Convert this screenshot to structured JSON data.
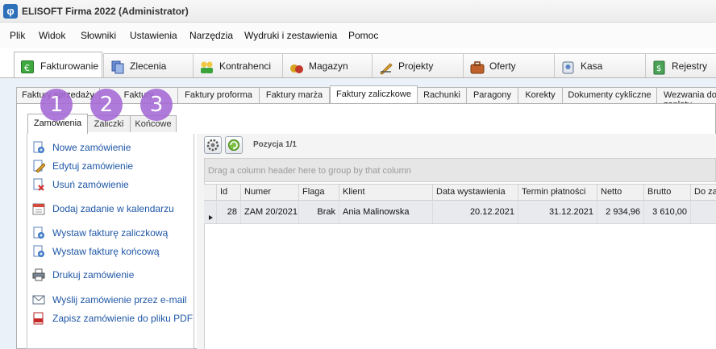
{
  "window": {
    "title": "ELISOFT Firma 2022 (Administrator)",
    "app_icon": "phi-logo-icon"
  },
  "menu": [
    "Plik",
    "Widok",
    "Słowniki",
    "Ustawienia",
    "Narzędzia",
    "Wydruki i zestawienia",
    "Pomoc"
  ],
  "main_tabs": [
    {
      "label": "Fakturowanie",
      "icon": "currency-icon",
      "active": true
    },
    {
      "label": "Zlecenia",
      "icon": "documents-icon"
    },
    {
      "label": "Kontrahenci",
      "icon": "people-icon"
    },
    {
      "label": "Magazyn",
      "icon": "bags-icon"
    },
    {
      "label": "Projekty",
      "icon": "pencil-ruler-icon"
    },
    {
      "label": "Oferty",
      "icon": "briefcase-icon"
    },
    {
      "label": "Kasa",
      "icon": "cash-register-icon"
    },
    {
      "label": "Rejestry",
      "icon": "register-book-icon"
    }
  ],
  "sub_tabs": [
    {
      "label": "Faktury sprzedaży"
    },
    {
      "label": "Faktury"
    },
    {
      "label": "Faktury proforma"
    },
    {
      "label": "Faktury marża"
    },
    {
      "label": "Faktury zaliczkowe",
      "active": true
    },
    {
      "label": "Rachunki"
    },
    {
      "label": "Paragony"
    },
    {
      "label": "Korekty"
    },
    {
      "label": "Dokumenty cykliczne"
    },
    {
      "label": "Wezwania do zapłaty"
    }
  ],
  "inner_tabs": [
    {
      "label": "Zamówienia",
      "active": true
    },
    {
      "label": "Zaliczki"
    },
    {
      "label": "Końcowe"
    }
  ],
  "badges": [
    "1",
    "2",
    "3"
  ],
  "actions": [
    {
      "label": "Nowe zamówienie",
      "icon": "new-document-icon"
    },
    {
      "label": "Edytuj zamówienie",
      "icon": "edit-document-icon"
    },
    {
      "label": "Usuń zamówienie",
      "icon": "delete-document-icon"
    },
    {
      "label": "Dodaj zadanie w kalendarzu",
      "icon": "calendar-icon"
    },
    {
      "label": "Wystaw fakturę zaliczkową",
      "icon": "new-document-icon"
    },
    {
      "label": "Wystaw fakturę końcową",
      "icon": "new-document-icon"
    },
    {
      "label": "Drukuj zamówienie",
      "icon": "printer-icon"
    },
    {
      "label": "Wyślij zamówienie przez e-mail",
      "icon": "email-icon"
    },
    {
      "label": "Zapisz zamówienie do pliku PDF",
      "icon": "pdf-icon"
    }
  ],
  "toolbar": {
    "position_label": "Pozycja 1/1",
    "settings_icon": "gear-icon",
    "refresh_icon": "refresh-icon"
  },
  "grid": {
    "group_hint": "Drag a column header here to group by that column",
    "columns": [
      "Id",
      "Numer",
      "Flaga",
      "Klient",
      "Data wystawienia",
      "Termin płatności",
      "Netto",
      "Brutto",
      "Do zapłaty"
    ],
    "rows": [
      {
        "id": "28",
        "numer": "ZAM 20/2021",
        "flaga": "Brak",
        "klient": "Ania Malinowska",
        "data": "20.12.2021",
        "termin": "31.12.2021",
        "netto": "2 934,96",
        "brutto": "3 610,00",
        "do_zaplaty": ""
      }
    ]
  },
  "colors": {
    "badge": "#a569d6",
    "link": "#1f57a6",
    "accent_bg": "#eaf1f8"
  }
}
